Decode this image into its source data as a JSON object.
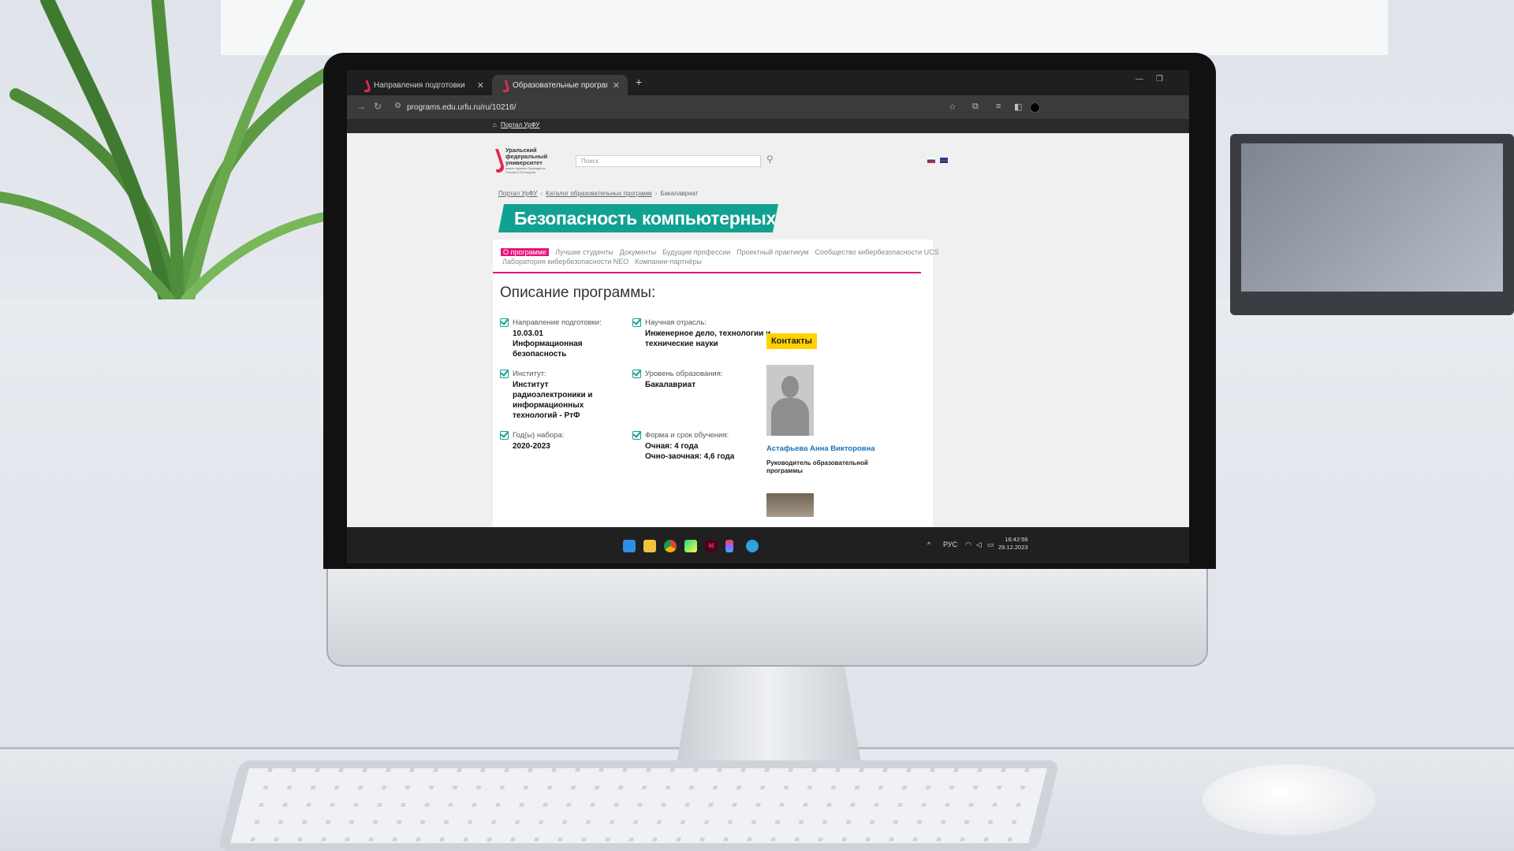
{
  "browser": {
    "tabs": [
      {
        "label": "Направления подготовки",
        "active": false
      },
      {
        "label": "Образовательные программы",
        "active": true
      }
    ],
    "url": "programs.edu.urfu.ru/ru/10216/",
    "bookmark": "Портал УрФУ"
  },
  "site": {
    "logo_text": "Уральский федеральный университет",
    "logo_sub": "имени первого Президента России Б.Н.Ельцина",
    "search_placeholder": "Поиск",
    "languages": [
      "ru",
      "en"
    ]
  },
  "breadcrumbs": [
    "Портал УрФУ",
    "Каталог образовательных программ",
    "Бакалавриат"
  ],
  "program_title": "Безопасность компьютерных систем",
  "menu": [
    {
      "label": "О программе",
      "active": true
    },
    {
      "label": "Лучшие студенты",
      "active": false
    },
    {
      "label": "Документы",
      "active": false
    },
    {
      "label": "Будущие профессии",
      "active": false
    },
    {
      "label": "Проектный практикум",
      "active": false
    },
    {
      "label": "Сообщество кибербезопасности UCS",
      "active": false
    },
    {
      "label": "Лаборатория кибербезопасности NEO",
      "active": false
    },
    {
      "label": "Компании-партнёры",
      "active": false
    }
  ],
  "description": {
    "heading": "Описание программы:",
    "fields": [
      {
        "label": "Направление подготовки:",
        "value": "10.03.01 Информационная безопасность"
      },
      {
        "label": "Научная отрасль:",
        "value": "Инженерное дело, технологии и технические науки"
      },
      {
        "label": "Институт:",
        "value": "Институт радиоэлектроники и информационных технологий - РтФ"
      },
      {
        "label": "Уровень образования:",
        "value": "Бакалавриат"
      },
      {
        "label": "Год(ы) набора:",
        "value": "2020-2023"
      },
      {
        "label": "Форма и срок обучения:",
        "value": "Очная: 4 года\nОчно-заочная: 4,6 года"
      }
    ]
  },
  "contacts": {
    "button": "Контакты",
    "name": "Астафьева Анна Викторовна",
    "role": "Руководитель образовательной программы"
  },
  "taskbar": {
    "language": "РУС",
    "time": "16:42:56",
    "date": "29.12.2023"
  }
}
